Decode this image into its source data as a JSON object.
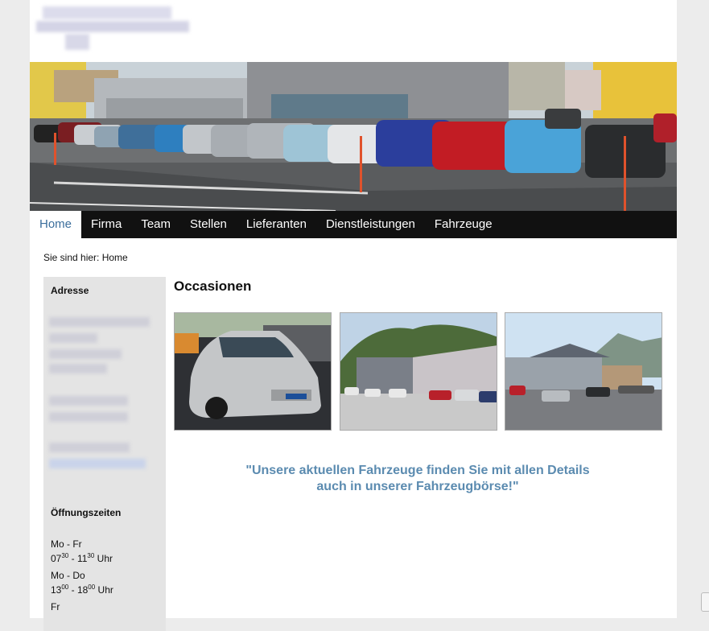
{
  "nav": {
    "items": [
      {
        "label": "Home",
        "active": true
      },
      {
        "label": "Firma"
      },
      {
        "label": "Team"
      },
      {
        "label": "Stellen"
      },
      {
        "label": "Lieferanten"
      },
      {
        "label": "Dienstleistungen"
      },
      {
        "label": "Fahrzeuge"
      }
    ]
  },
  "breadcrumb": {
    "text": "Sie sind hier: Home"
  },
  "sidebar": {
    "address_heading": "Adresse",
    "hours_heading": "Öffnungszeiten",
    "hours": {
      "day1": "Mo - Fr",
      "time1_start_h": "07",
      "time1_start_m": "30",
      "time1_sep": " - ",
      "time1_end_h": "11",
      "time1_end_m": "30",
      "time1_unit": " Uhr",
      "day2": "Mo - Do",
      "time2_start_h": "13",
      "time2_start_m": "00",
      "time2_sep": " - ",
      "time2_end_h": "18",
      "time2_end_m": "00",
      "time2_unit": " Uhr",
      "day3": "Fr"
    }
  },
  "content": {
    "title": "Occasionen",
    "quote_line1": "\"Unsere aktuellen Fahrzeuge finden Sie mit allen Details",
    "quote_line2": "auch in unserer Fahrzeugbörse!\""
  },
  "colors": {
    "nav_bg": "#111111",
    "link": "#3b6e9c",
    "quote": "#5b8bb0",
    "sidebar_bg": "#e4e4e4"
  }
}
